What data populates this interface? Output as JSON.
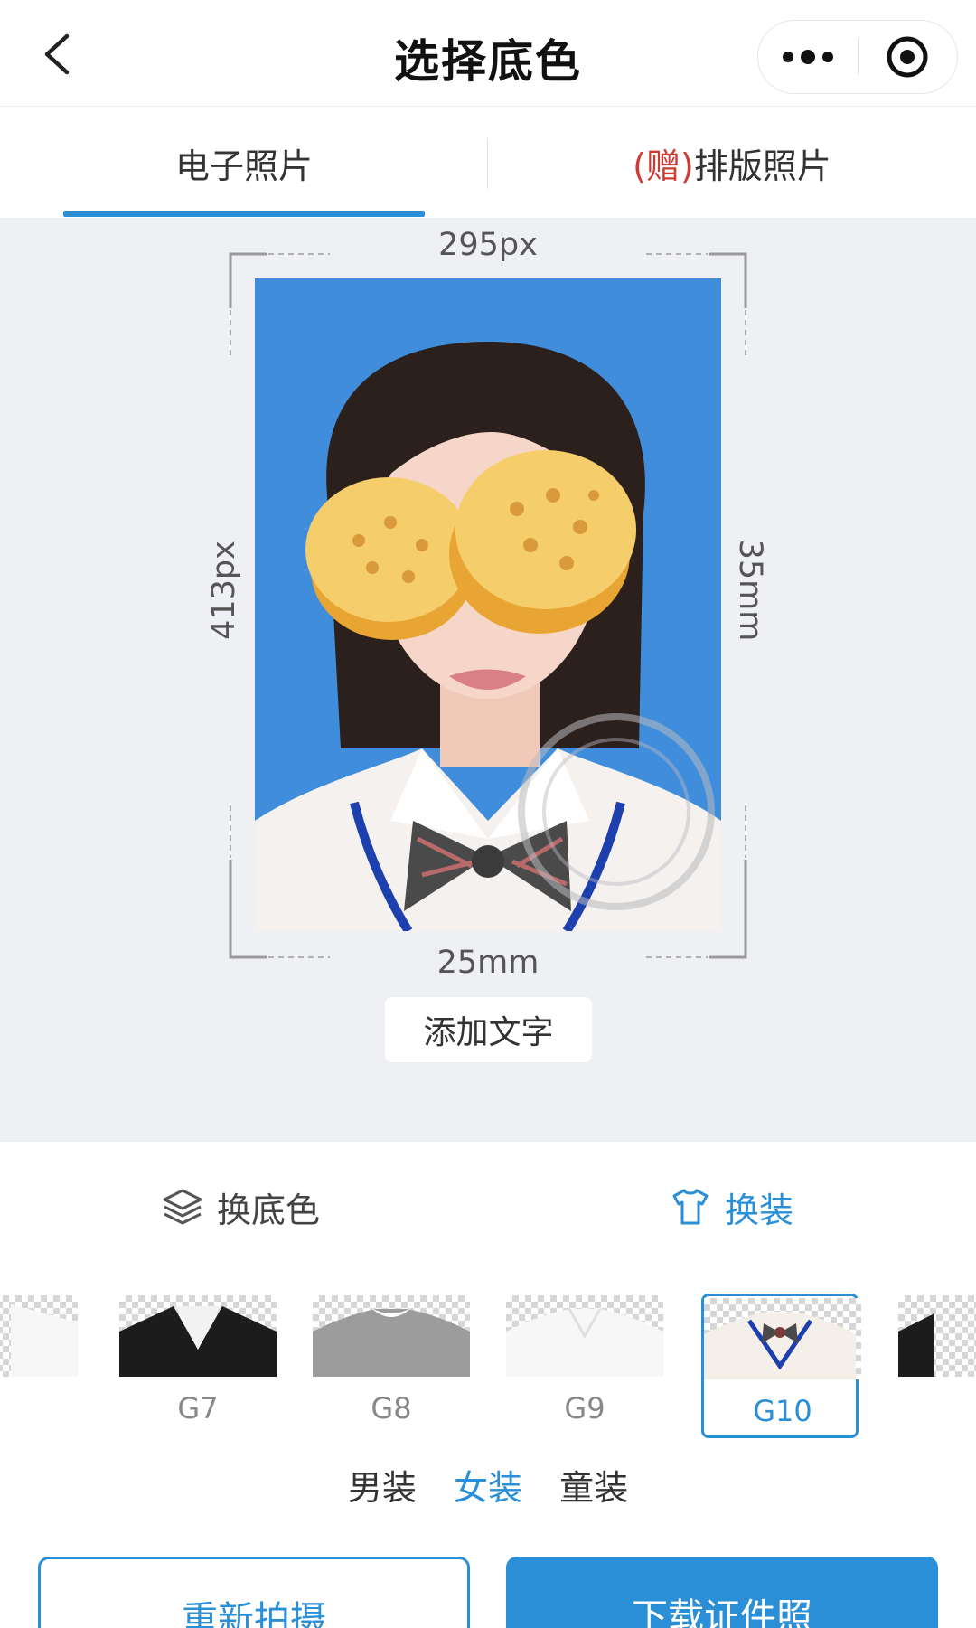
{
  "header": {
    "title": "选择底色"
  },
  "tabs": [
    {
      "label": "电子照片",
      "active": true
    },
    {
      "gift_tag": "(赠)",
      "label": "排版照片",
      "active": false
    }
  ],
  "preview": {
    "width_px": "295px",
    "height_px": "413px",
    "width_mm": "25mm",
    "height_mm": "35mm",
    "background_color": "#3f8ddb",
    "add_text_label": "添加文字"
  },
  "panel": {
    "change_background_label": "换底色",
    "change_outfit_label": "换装",
    "outfits": [
      {
        "code": "G7"
      },
      {
        "code": "G8"
      },
      {
        "code": "G9"
      },
      {
        "code": "G10",
        "selected": true
      }
    ],
    "categories": [
      {
        "label": "男装",
        "active": false
      },
      {
        "label": "女装",
        "active": true
      },
      {
        "label": "童装",
        "active": false
      }
    ],
    "retake_label": "重新拍摄",
    "download_label": "下载证件照"
  },
  "colors": {
    "accent": "#2a8fd6",
    "gift": "#cf3a33"
  }
}
